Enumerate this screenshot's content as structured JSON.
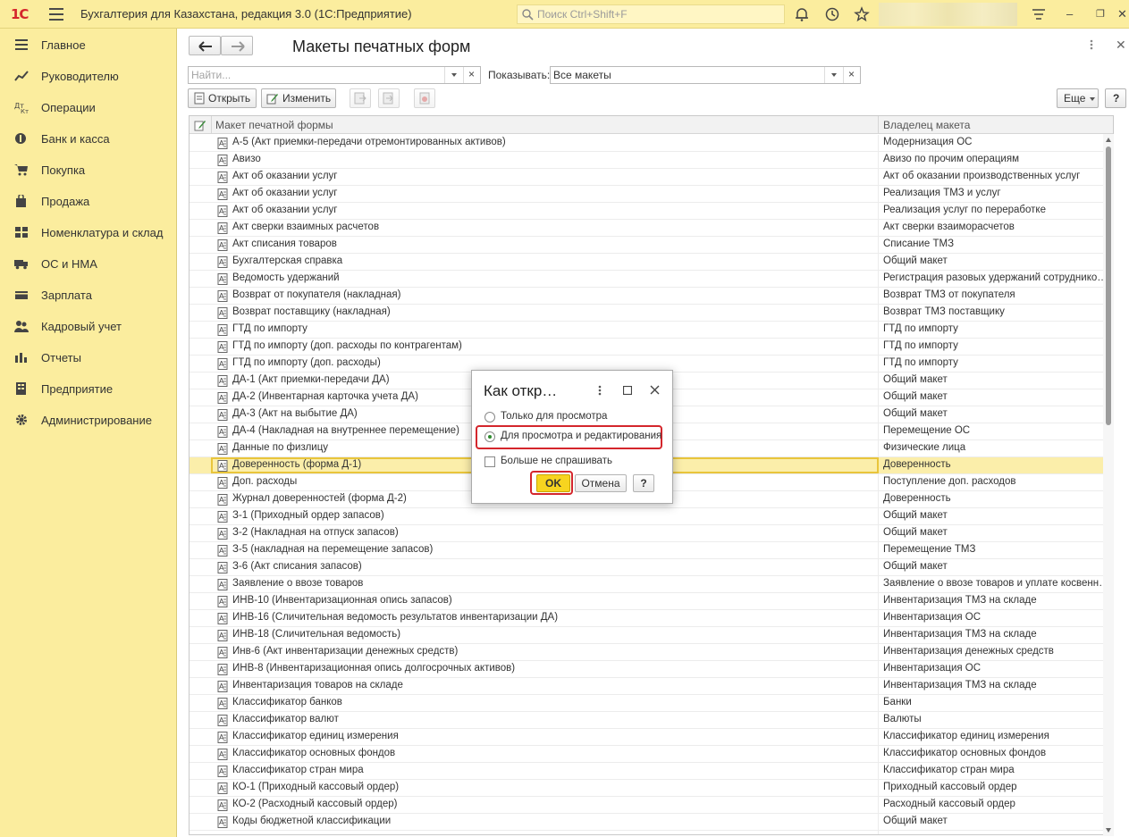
{
  "app": {
    "logo": "1С",
    "title": "Бухгалтерия для Казахстана, редакция 3.0  (1С:Предприятие)",
    "search_placeholder": "Поиск Ctrl+Shift+F"
  },
  "sidebar": {
    "items": [
      {
        "label": "Главное",
        "icon": "menu-lines-icon"
      },
      {
        "label": "Руководителю",
        "icon": "trend-chart-icon"
      },
      {
        "label": "Операции",
        "icon": "debit-credit-icon"
      },
      {
        "label": "Банк и касса",
        "icon": "coin-icon"
      },
      {
        "label": "Покупка",
        "icon": "cart-icon"
      },
      {
        "label": "Продажа",
        "icon": "bag-icon"
      },
      {
        "label": "Номенклатура и склад",
        "icon": "grid-icon"
      },
      {
        "label": "ОС и НМА",
        "icon": "truck-icon"
      },
      {
        "label": "Зарплата",
        "icon": "wallet-icon"
      },
      {
        "label": "Кадровый учет",
        "icon": "people-icon"
      },
      {
        "label": "Отчеты",
        "icon": "bars-icon"
      },
      {
        "label": "Предприятие",
        "icon": "building-icon"
      },
      {
        "label": "Администрирование",
        "icon": "gear-icon"
      }
    ]
  },
  "form": {
    "title": "Макеты печатных форм",
    "search_placeholder": "Найти...",
    "show_label": "Показывать:",
    "show_value": "Все макеты",
    "open_label": "Открыть",
    "edit_label": "Изменить",
    "more_label": "Еще",
    "help_label": "?",
    "columns": [
      "Макет печатной формы",
      "Владелец макета"
    ],
    "rows": [
      [
        "А-5 (Акт приемки-передачи отремонтированных активов)",
        "Модернизация ОС"
      ],
      [
        "Авизо",
        "Авизо по прочим операциям"
      ],
      [
        "Акт об оказании услуг",
        "Акт об оказании производственных услуг"
      ],
      [
        "Акт об оказании услуг",
        "Реализация ТМЗ и услуг"
      ],
      [
        "Акт об оказании услуг",
        "Реализация услуг по переработке"
      ],
      [
        "Акт сверки взаимных расчетов",
        "Акт сверки взаиморасчетов"
      ],
      [
        "Акт списания товаров",
        "Списание ТМЗ"
      ],
      [
        "Бухгалтерская справка",
        "Общий макет"
      ],
      [
        "Ведомость удержаний",
        "Регистрация разовых удержаний сотрудников о..."
      ],
      [
        "Возврат от покупателя (накладная)",
        "Возврат ТМЗ от покупателя"
      ],
      [
        "Возврат поставщику (накладная)",
        "Возврат ТМЗ поставщику"
      ],
      [
        "ГТД по импорту",
        "ГТД по импорту"
      ],
      [
        "ГТД по импорту (доп. расходы по контрагентам)",
        "ГТД по импорту"
      ],
      [
        "ГТД по импорту (доп. расходы)",
        "ГТД по импорту"
      ],
      [
        "ДА-1 (Акт приемки-передачи ДА)",
        "Общий макет"
      ],
      [
        "ДА-2 (Инвентарная карточка учета ДА)",
        "Общий макет"
      ],
      [
        "ДА-3 (Акт на выбытие ДА)",
        "Общий макет"
      ],
      [
        "ДА-4 (Накладная на внутреннее перемещение)",
        "Перемещение ОС"
      ],
      [
        "Данные по физлицу",
        "Физические лица"
      ],
      [
        "Доверенность (форма Д-1)",
        "Доверенность"
      ],
      [
        "Доп. расходы",
        "Поступление доп. расходов"
      ],
      [
        "Журнал доверенностей (форма Д-2)",
        "Доверенность"
      ],
      [
        "З-1 (Приходный ордер запасов)",
        "Общий макет"
      ],
      [
        "З-2 (Накладная на отпуск запасов)",
        "Общий макет"
      ],
      [
        "З-5 (накладная на перемещение запасов)",
        "Перемещение ТМЗ"
      ],
      [
        "З-6 (Акт списания запасов)",
        "Общий макет"
      ],
      [
        "Заявление о ввозе товаров",
        "Заявление о ввозе товаров и уплате косвенных ..."
      ],
      [
        "ИНВ-10 (Инвентаризационная опись запасов)",
        "Инвентаризация ТМЗ на складе"
      ],
      [
        "ИНВ-16 (Сличительная ведомость результатов инвентаризации ДА)",
        "Инвентаризация ОС"
      ],
      [
        "ИНВ-18 (Сличительная ведомость)",
        "Инвентаризация ТМЗ на складе"
      ],
      [
        "Инв-6 (Акт инвентаризации денежных средств)",
        "Инвентаризация денежных средств"
      ],
      [
        "ИНВ-8 (Инвентаризационная опись долгосрочных активов)",
        "Инвентаризация ОС"
      ],
      [
        "Инвентаризация товаров на складе",
        "Инвентаризация ТМЗ на складе"
      ],
      [
        "Классификатор банков",
        "Банки"
      ],
      [
        "Классификатор валют",
        "Валюты"
      ],
      [
        "Классификатор единиц измерения",
        "Классификатор единиц измерения"
      ],
      [
        "Классификатор основных фондов",
        "Классификатор основных фондов"
      ],
      [
        "Классификатор стран мира",
        "Классификатор стран мира"
      ],
      [
        "КО-1 (Приходный кассовый ордер)",
        "Приходный кассовый ордер"
      ],
      [
        "КО-2 (Расходный кассовый ордер)",
        "Расходный кассовый ордер"
      ],
      [
        "Коды бюджетной классификации",
        "Общий макет"
      ]
    ],
    "selected_row": 19
  },
  "dialog": {
    "title": "Как откр…",
    "option_view": "Только для просмотра",
    "option_edit": "Для просмотра и редактирования",
    "selected_option": "option_edit",
    "dont_ask": "Больше не спрашивать",
    "dont_ask_checked": false,
    "ok": "OK",
    "cancel": "Отмена",
    "help": "?"
  }
}
